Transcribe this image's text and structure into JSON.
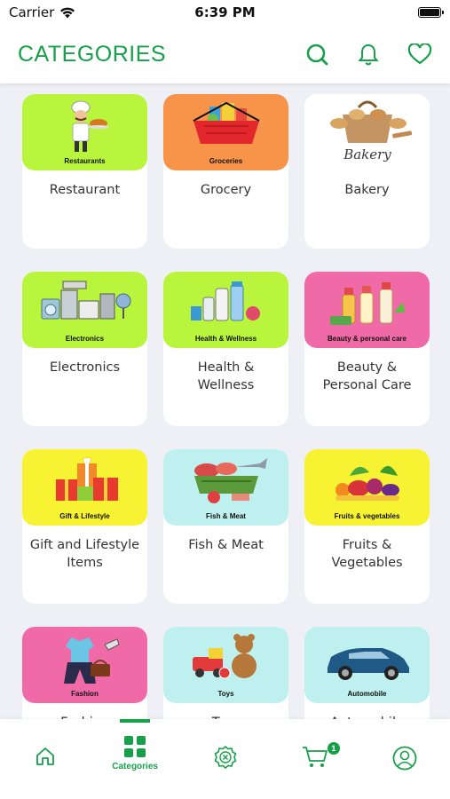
{
  "status_bar": {
    "carrier": "Carrier",
    "time": "6:39 PM"
  },
  "header": {
    "title": "CATEGORIES",
    "icons": [
      "search-icon",
      "bell-icon",
      "heart-icon"
    ]
  },
  "colors": {
    "accent": "#17a04a",
    "lime": "#b8f43a",
    "orange": "#f79a4e",
    "pink": "#f06aa8",
    "yellow": "#f6f432",
    "cyan": "#bff0ee"
  },
  "categories": [
    {
      "caption": "Restaurants",
      "label": "Restaurant",
      "banner": "#b9f53d"
    },
    {
      "caption": "Groceries",
      "label": "Grocery",
      "banner": "#f7944a"
    },
    {
      "caption": "",
      "label": "Bakery",
      "banner": "#ffffff",
      "logo_text": "Bakery"
    },
    {
      "caption": "Electronics",
      "label": "Electronics",
      "banner": "#b9f53d"
    },
    {
      "caption": "Health & Wellness",
      "label": "Health & Wellness",
      "banner": "#b9f53d"
    },
    {
      "caption": "Beauty & personal care",
      "label": "Beauty & Personal Care",
      "banner": "#f06aa8"
    },
    {
      "caption": "Gift & Lifestyle",
      "label": "Gift and Lifestyle Items",
      "banner": "#f7f232"
    },
    {
      "caption": "Fish & Meat",
      "label": "Fish & Meat",
      "banner": "#bef0ef"
    },
    {
      "caption": "Fruits & vegetables",
      "label": "Fruits & Vegetables",
      "banner": "#f7f232"
    },
    {
      "caption": "Fashion",
      "label": "Fashion",
      "banner": "#f06aa8"
    },
    {
      "caption": "Toys",
      "label": "Toys",
      "banner": "#bef0ef"
    },
    {
      "caption": "Automobile",
      "label": "Automobile",
      "banner": "#bef0ef"
    }
  ],
  "bottom_nav": {
    "home": "home-icon",
    "categories_label": "Categories",
    "offers": "offer-badge-icon",
    "cart": "cart-icon",
    "cart_count": "1",
    "profile": "profile-icon"
  }
}
